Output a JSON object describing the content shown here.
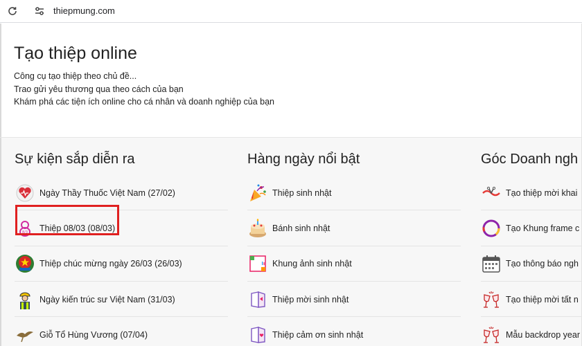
{
  "browser": {
    "url": "thiepmung.com"
  },
  "hero": {
    "title": "Tạo thiệp online",
    "lines": [
      "Công cụ tạo thiệp theo chủ đề...",
      "Trao gửi yêu thương qua theo cách của bạn",
      "Khám phá các tiện ích online cho cá nhân và doanh nghiệp của bạn"
    ]
  },
  "columns": [
    {
      "title": "Sự kiện sắp diễn ra",
      "items": [
        {
          "label": "Ngày Thầy Thuốc Việt Nam (27/02)",
          "icon": "doctor-heart-icon"
        },
        {
          "label": "Thiệp 08/03 (08/03)",
          "icon": "women-day-icon"
        },
        {
          "label": "Thiệp chúc mừng ngày 26/03 (26/03)",
          "icon": "youth-union-icon"
        },
        {
          "label": "Ngày kiến trúc sư Việt Nam (31/03)",
          "icon": "architect-icon"
        },
        {
          "label": "Giỗ Tổ Hùng Vương (07/04)",
          "icon": "bird-icon"
        }
      ]
    },
    {
      "title": "Hàng ngày nổi bật",
      "items": [
        {
          "label": "Thiệp sinh nhật",
          "icon": "party-popper-icon"
        },
        {
          "label": "Bánh sinh nhật",
          "icon": "birthday-cake-icon"
        },
        {
          "label": "Khung ảnh sinh nhật",
          "icon": "photo-frame-icon"
        },
        {
          "label": "Thiệp mời sinh nhật",
          "icon": "invitation-card-icon"
        },
        {
          "label": "Thiệp cảm ơn sinh nhật",
          "icon": "thank-you-card-icon"
        }
      ]
    },
    {
      "title": "Góc Doanh ngh",
      "items": [
        {
          "label": "Tạo thiệp mời khai",
          "icon": "ribbon-cut-icon"
        },
        {
          "label": "Tạo Khung frame c",
          "icon": "round-frame-icon"
        },
        {
          "label": "Tạo thông báo ngh",
          "icon": "calendar-icon"
        },
        {
          "label": "Tạo thiệp mời tất n",
          "icon": "cheers-icon"
        },
        {
          "label": "Mẫu backdrop year",
          "icon": "cheers-icon"
        }
      ]
    }
  ],
  "colors": {
    "highlight": "#e02020",
    "lower_bg": "#f7f7f7"
  }
}
